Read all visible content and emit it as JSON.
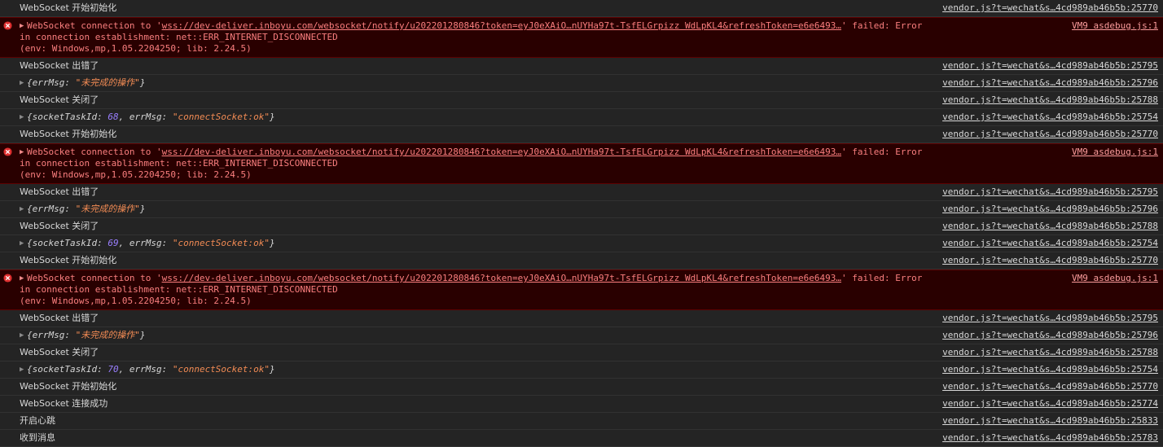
{
  "console": {
    "theme": {
      "background": "#242424",
      "error_background": "#290000",
      "error_border": "#5c0000",
      "row_divider": "#323232",
      "text": "#d8d8d8",
      "error_text": "#fa7f7f",
      "number_token": "#9a7fff",
      "string_token": "#f28b54"
    },
    "error_icon_name": "error-circle-icon",
    "expand_triangle": "▶",
    "messages": [
      {
        "type": "log",
        "text": "WebSocket 开始初始化",
        "source": "vendor.js?t=wechat&s…4cd989ab46b5b:25770"
      },
      {
        "type": "error",
        "prefix": "WebSocket connection to '",
        "url": "wss://dev-deliver.inboyu.com/websocket/notify/u202201280846?token=eyJ0eXAiO…nUYHa97t-TsfELGrpizz WdLpKL4&refreshToken=e6e6493…",
        "suffix": "' failed: Error in connection establishment: net::ERR_INTERNET_DISCONNECTED\n(env: Windows,mp,1.05.2204250; lib: 2.24.5)",
        "source": "VM9 asdebug.js:1"
      },
      {
        "type": "log",
        "text": "WebSocket 出错了",
        "source": "vendor.js?t=wechat&s…4cd989ab46b5b:25795"
      },
      {
        "type": "object",
        "parts": [
          {
            "k": "{errMsg: ",
            "c": "key"
          },
          {
            "k": "\"未完成的操作\"",
            "c": "str"
          },
          {
            "k": "}",
            "c": "key"
          }
        ],
        "source": "vendor.js?t=wechat&s…4cd989ab46b5b:25796"
      },
      {
        "type": "log",
        "text": "WebSocket 关闭了",
        "source": "vendor.js?t=wechat&s…4cd989ab46b5b:25788"
      },
      {
        "type": "object",
        "parts": [
          {
            "k": "{socketTaskId: ",
            "c": "key"
          },
          {
            "k": "68",
            "c": "num"
          },
          {
            "k": ", errMsg: ",
            "c": "key"
          },
          {
            "k": "\"connectSocket:ok\"",
            "c": "str"
          },
          {
            "k": "}",
            "c": "key"
          }
        ],
        "source": "vendor.js?t=wechat&s…4cd989ab46b5b:25754"
      },
      {
        "type": "log",
        "text": "WebSocket 开始初始化",
        "source": "vendor.js?t=wechat&s…4cd989ab46b5b:25770"
      },
      {
        "type": "error",
        "prefix": "WebSocket connection to '",
        "url": "wss://dev-deliver.inboyu.com/websocket/notify/u202201280846?token=eyJ0eXAiO…nUYHa97t-TsfELGrpizz WdLpKL4&refreshToken=e6e6493…",
        "suffix": "' failed: Error in connection establishment: net::ERR_INTERNET_DISCONNECTED\n(env: Windows,mp,1.05.2204250; lib: 2.24.5)",
        "source": "VM9 asdebug.js:1"
      },
      {
        "type": "log",
        "text": "WebSocket 出错了",
        "source": "vendor.js?t=wechat&s…4cd989ab46b5b:25795"
      },
      {
        "type": "object",
        "parts": [
          {
            "k": "{errMsg: ",
            "c": "key"
          },
          {
            "k": "\"未完成的操作\"",
            "c": "str"
          },
          {
            "k": "}",
            "c": "key"
          }
        ],
        "source": "vendor.js?t=wechat&s…4cd989ab46b5b:25796"
      },
      {
        "type": "log",
        "text": "WebSocket 关闭了",
        "source": "vendor.js?t=wechat&s…4cd989ab46b5b:25788"
      },
      {
        "type": "object",
        "parts": [
          {
            "k": "{socketTaskId: ",
            "c": "key"
          },
          {
            "k": "69",
            "c": "num"
          },
          {
            "k": ", errMsg: ",
            "c": "key"
          },
          {
            "k": "\"connectSocket:ok\"",
            "c": "str"
          },
          {
            "k": "}",
            "c": "key"
          }
        ],
        "source": "vendor.js?t=wechat&s…4cd989ab46b5b:25754"
      },
      {
        "type": "log",
        "text": "WebSocket 开始初始化",
        "source": "vendor.js?t=wechat&s…4cd989ab46b5b:25770"
      },
      {
        "type": "error",
        "prefix": "WebSocket connection to '",
        "url": "wss://dev-deliver.inboyu.com/websocket/notify/u202201280846?token=eyJ0eXAiO…nUYHa97t-TsfELGrpizz WdLpKL4&refreshToken=e6e6493…",
        "suffix": "' failed: Error in connection establishment: net::ERR_INTERNET_DISCONNECTED\n(env: Windows,mp,1.05.2204250; lib: 2.24.5)",
        "source": "VM9 asdebug.js:1"
      },
      {
        "type": "log",
        "text": "WebSocket 出错了",
        "source": "vendor.js?t=wechat&s…4cd989ab46b5b:25795"
      },
      {
        "type": "object",
        "parts": [
          {
            "k": "{errMsg: ",
            "c": "key"
          },
          {
            "k": "\"未完成的操作\"",
            "c": "str"
          },
          {
            "k": "}",
            "c": "key"
          }
        ],
        "source": "vendor.js?t=wechat&s…4cd989ab46b5b:25796"
      },
      {
        "type": "log",
        "text": "WebSocket 关闭了",
        "source": "vendor.js?t=wechat&s…4cd989ab46b5b:25788"
      },
      {
        "type": "object",
        "parts": [
          {
            "k": "{socketTaskId: ",
            "c": "key"
          },
          {
            "k": "70",
            "c": "num"
          },
          {
            "k": ", errMsg: ",
            "c": "key"
          },
          {
            "k": "\"connectSocket:ok\"",
            "c": "str"
          },
          {
            "k": "}",
            "c": "key"
          }
        ],
        "source": "vendor.js?t=wechat&s…4cd989ab46b5b:25754"
      },
      {
        "type": "log",
        "text": "WebSocket 开始初始化",
        "source": "vendor.js?t=wechat&s…4cd989ab46b5b:25770"
      },
      {
        "type": "log",
        "text": "WebSocket 连接成功",
        "source": "vendor.js?t=wechat&s…4cd989ab46b5b:25774"
      },
      {
        "type": "log",
        "text": "开启心跳",
        "source": "vendor.js?t=wechat&s…4cd989ab46b5b:25833"
      },
      {
        "type": "log",
        "text": "收到消息",
        "source": "vendor.js?t=wechat&s…4cd989ab46b5b:25783"
      }
    ]
  }
}
